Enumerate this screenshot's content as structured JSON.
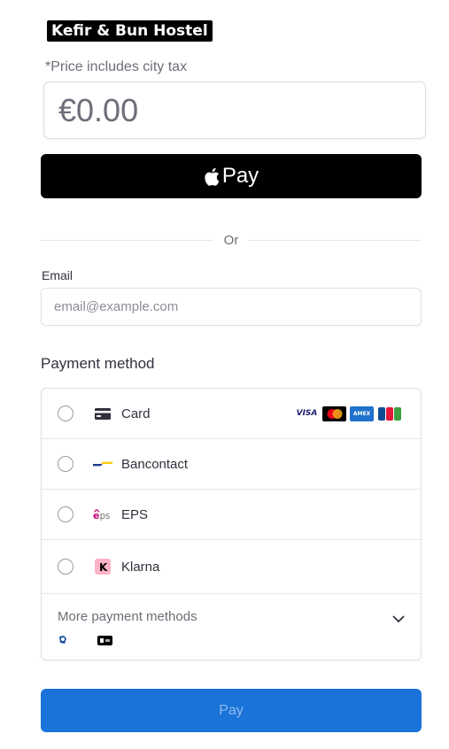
{
  "merchant": {
    "name": "Kefir & Bun Hostel"
  },
  "price": {
    "note": "*Price includes city tax",
    "value": "€0.00"
  },
  "apple_pay": {
    "label": "Pay"
  },
  "divider": {
    "text": "Or"
  },
  "email": {
    "label": "Email",
    "placeholder": "email@example.com"
  },
  "payment_method": {
    "title": "Payment method",
    "options": [
      {
        "label": "Card",
        "icon": "card-icon"
      },
      {
        "label": "Bancontact",
        "icon": "bancontact-icon"
      },
      {
        "label": "EPS",
        "icon": "eps-icon"
      },
      {
        "label": "Klarna",
        "icon": "klarna-icon"
      }
    ],
    "card_brands": [
      "VISA",
      "mastercard",
      "AMEX",
      "JCB"
    ],
    "more": {
      "label": "More payment methods"
    }
  },
  "pay_button": {
    "label": "Pay"
  },
  "colors": {
    "accent": "#1a73d9",
    "pay_text": "#8fbcef",
    "apple_pay_bg": "#000000"
  }
}
